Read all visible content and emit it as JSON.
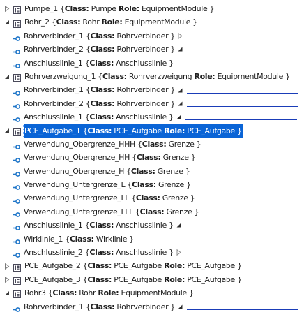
{
  "colors": {
    "selection": "#0a64d6",
    "link_line": "#1a3db8",
    "node_icon": "#4a4a5a",
    "interface_icon": "#1f76c9"
  },
  "tree": [
    {
      "level": 0,
      "expander": "collapsed",
      "icon": "internal-element-icon",
      "name": "Pumpe_1",
      "class": "Pumpe",
      "role": "EquipmentModule",
      "tail": "none"
    },
    {
      "level": 0,
      "expander": "expanded",
      "icon": "internal-element-icon",
      "name": "Rohr_2",
      "class": "Rohr",
      "role": "EquipmentModule",
      "tail": "none"
    },
    {
      "level": 1,
      "expander": "none",
      "icon": "interface-icon",
      "name": "Rohrverbinder_1",
      "class": "Rohrverbinder",
      "role": "",
      "tail": "hollow"
    },
    {
      "level": 1,
      "expander": "none",
      "icon": "interface-icon",
      "name": "Rohrverbinder_2",
      "class": "Rohrverbinder",
      "role": "",
      "tail": "linked",
      "line": 0.42
    },
    {
      "level": 1,
      "expander": "none",
      "icon": "interface-icon",
      "name": "Anschlusslinie_1",
      "class": "Anschlusslinie",
      "role": "",
      "tail": "none"
    },
    {
      "level": 0,
      "expander": "expanded",
      "icon": "internal-element-icon",
      "name": "Rohrverzweigung_1",
      "class": "Rohrverzweigung",
      "role": "EquipmentModule",
      "tail": "none"
    },
    {
      "level": 1,
      "expander": "none",
      "icon": "interface-icon",
      "name": "Rohrverbinder_1",
      "class": "Rohrverbinder",
      "role": "",
      "tail": "linked",
      "line": 0.4
    },
    {
      "level": 1,
      "expander": "none",
      "icon": "interface-icon",
      "name": "Rohrverbinder_2",
      "class": "Rohrverbinder",
      "role": "",
      "tail": "linked",
      "line": 0.4
    },
    {
      "level": 1,
      "expander": "none",
      "icon": "interface-icon",
      "name": "Anschlusslinie_1",
      "class": "Anschlusslinie",
      "role": "",
      "tail": "linked",
      "line": 0.4
    },
    {
      "level": 0,
      "expander": "expanded",
      "icon": "internal-element-icon",
      "name": "PCE_Aufgabe_1",
      "class": "PCE_Aufgabe",
      "role": "PCE_Aufgabe",
      "tail": "none",
      "selected": true
    },
    {
      "level": 1,
      "expander": "none",
      "icon": "interface-icon",
      "name": "Verwendung_Obergrenze_HHH",
      "class": "Grenze",
      "role": "",
      "tail": "none"
    },
    {
      "level": 1,
      "expander": "none",
      "icon": "interface-icon",
      "name": "Verwendung_Obergrenze_HH",
      "class": "Grenze",
      "role": "",
      "tail": "none"
    },
    {
      "level": 1,
      "expander": "none",
      "icon": "interface-icon",
      "name": "Verwendung_Obergrenze_H",
      "class": "Grenze",
      "role": "",
      "tail": "none"
    },
    {
      "level": 1,
      "expander": "none",
      "icon": "interface-icon",
      "name": "Verwendung_Untergrenze_L",
      "class": "Grenze",
      "role": "",
      "tail": "none"
    },
    {
      "level": 1,
      "expander": "none",
      "icon": "interface-icon",
      "name": "Verwendung_Untergrenze_LL",
      "class": "Grenze",
      "role": "",
      "tail": "none"
    },
    {
      "level": 1,
      "expander": "none",
      "icon": "interface-icon",
      "name": "Verwendung_Untergrenze_LLL",
      "class": "Grenze",
      "role": "",
      "tail": "none"
    },
    {
      "level": 1,
      "expander": "none",
      "icon": "interface-icon",
      "name": "Anschlusslinie_1",
      "class": "Anschlusslinie",
      "role": "",
      "tail": "linked",
      "line": 0.35
    },
    {
      "level": 1,
      "expander": "none",
      "icon": "interface-icon",
      "name": "Wirklinie_1",
      "class": "Wirklinie",
      "role": "",
      "tail": "none"
    },
    {
      "level": 1,
      "expander": "none",
      "icon": "interface-icon",
      "name": "Anschlusslinie_2",
      "class": "Anschlusslinie",
      "role": "",
      "tail": "hollow"
    },
    {
      "level": 0,
      "expander": "collapsed",
      "icon": "internal-element-icon",
      "name": "PCE_Aufgabe_2",
      "class": "PCE_Aufgabe",
      "role": "PCE_Aufgabe",
      "tail": "none"
    },
    {
      "level": 0,
      "expander": "collapsed",
      "icon": "internal-element-icon",
      "name": "PCE_Aufgabe_3",
      "class": "PCE_Aufgabe",
      "role": "PCE_Aufgabe",
      "tail": "none"
    },
    {
      "level": 0,
      "expander": "expanded",
      "icon": "internal-element-icon",
      "name": "Rohr3",
      "class": "Rohr",
      "role": "EquipmentModule",
      "tail": "none"
    },
    {
      "level": 1,
      "expander": "none",
      "icon": "interface-icon",
      "name": "Rohrverbinder_1",
      "class": "Rohrverbinder",
      "role": "",
      "tail": "linked",
      "line": 0.4
    }
  ]
}
